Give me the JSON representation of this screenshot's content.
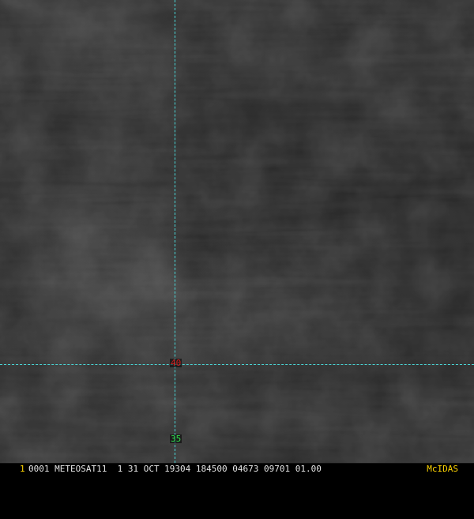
{
  "overlay": {
    "grid_labels": {
      "lat_40": "40",
      "lat_35": "35"
    },
    "line_color": "#49d7d7",
    "label_colors": {
      "lat_40": "#d11b1b",
      "lat_35": "#2fe04b"
    }
  },
  "footer": {
    "frame_number": "1",
    "info_text": "0001 METEOSAT11  1 31 OCT 19304 184500 04673 09701 01.00",
    "brand": "McIDAS",
    "colors": {
      "frame_number": "#ffd400",
      "brand": "#ffd400"
    }
  }
}
